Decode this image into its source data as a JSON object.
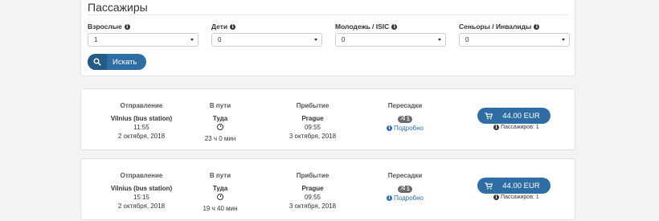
{
  "passengers": {
    "title": "Пассажиры",
    "fields": [
      {
        "label": "Взрослые",
        "value": "1"
      },
      {
        "label": "Дети",
        "value": "0"
      },
      {
        "label": "Молодежь / ISIC",
        "value": "0"
      },
      {
        "label": "Сеньоры / Инвалиды",
        "value": "0"
      }
    ],
    "search_label": "Искать"
  },
  "headers": {
    "departure": "Отправление",
    "trip": "В пути",
    "arrival": "Прибытие",
    "transfers": "Пересадки"
  },
  "results": [
    {
      "from": "Vilnius (bus station)",
      "dep_time": "11:55",
      "dep_date": "2 октября, 2018",
      "direction": "Туда",
      "duration": "23 ч 0 мин",
      "to": "Prague",
      "arr_time": "09:55",
      "arr_date": "3 октября, 2018",
      "transfers": "1",
      "details": "Подробно",
      "price": "44.00 EUR",
      "passengers": "Пассажиров: 1"
    },
    {
      "from": "Vilnius (bus station)",
      "dep_time": "15:15",
      "dep_date": "2 октября, 2018",
      "direction": "Туда",
      "duration": "19 ч 40 мин",
      "to": "Prague",
      "arr_time": "09:55",
      "arr_date": "3 октября, 2018",
      "transfers": "1",
      "details": "Подробно",
      "price": "44.00 EUR",
      "passengers": "Пассажиров: 1"
    }
  ],
  "colors": {
    "accent": "#2f6ea5",
    "link": "#2a6ebb",
    "badge": "#6b6b6b"
  },
  "icons": {
    "search": "search-icon",
    "cart": "cart-icon",
    "info": "info-icon",
    "clock": "clock-icon",
    "shuffle": "shuffle-icon"
  }
}
